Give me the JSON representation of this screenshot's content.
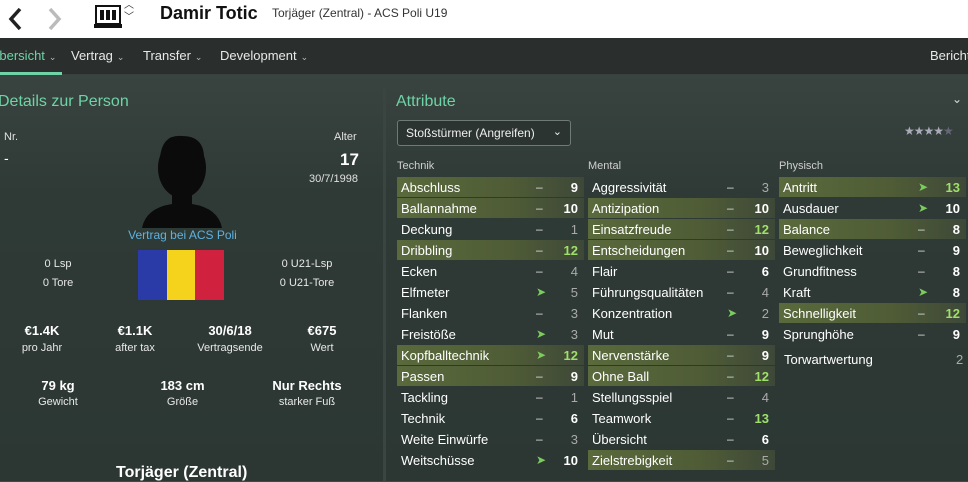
{
  "header": {
    "back_icon": "chevron-left-icon",
    "forward_icon": "chevron-right-icon",
    "name": "Damir Totic",
    "subtitle": "Torjäger (Zentral) - ACS Poli U19"
  },
  "menu": {
    "items": [
      {
        "label": "Übersicht",
        "active": true
      },
      {
        "label": "Vertrag"
      },
      {
        "label": "Transfer"
      },
      {
        "label": "Development"
      }
    ],
    "right_label": "Bericht"
  },
  "details": {
    "title": "Details zur Person",
    "nr_label": "Nr.",
    "nr_value": "-",
    "age_label": "Alter",
    "age_value": "17",
    "birthdate": "30/7/1998",
    "contract_text": "Vertrag bei ACS Poli",
    "lsp": "0 Lsp",
    "tore": "0 Tore",
    "u21lsp": "0 U21-Lsp",
    "u21tore": "0 U21-Tore",
    "stats": [
      {
        "value": "€1.4K",
        "label": "pro Jahr"
      },
      {
        "value": "€1.1K",
        "label": "after tax"
      },
      {
        "value": "30/6/18",
        "label": "Vertragsende"
      },
      {
        "value": "€675",
        "label": "Wert"
      }
    ],
    "body": [
      {
        "value": "79 kg",
        "label": "Gewicht"
      },
      {
        "value": "183 cm",
        "label": "Größe"
      },
      {
        "value": "Nur Rechts",
        "label": "starker Fuß"
      }
    ],
    "position": "Torjäger (Zentral)"
  },
  "attributes": {
    "title": "Attribute",
    "role": "Stoßstürmer (Angreifen)",
    "rating_stars": 4.5,
    "technik_label": "Technik",
    "mental_label": "Mental",
    "physisch_label": "Physisch",
    "technik": [
      {
        "n": "Abschluss",
        "t": "–",
        "v": "9",
        "h": true,
        "c": "mid"
      },
      {
        "n": "Ballannahme",
        "t": "–",
        "v": "10",
        "h": true,
        "c": "mid"
      },
      {
        "n": "Deckung",
        "t": "–",
        "v": "1",
        "h": false,
        "c": "lo"
      },
      {
        "n": "Dribbling",
        "t": "–",
        "v": "12",
        "h": true,
        "c": "hi"
      },
      {
        "n": "Ecken",
        "t": "–",
        "v": "4",
        "h": false,
        "c": "lo"
      },
      {
        "n": "Elfmeter",
        "t": "➤",
        "v": "5",
        "h": false,
        "c": "lo"
      },
      {
        "n": "Flanken",
        "t": "–",
        "v": "3",
        "h": false,
        "c": "lo"
      },
      {
        "n": "Freistöße",
        "t": "➤",
        "v": "3",
        "h": false,
        "c": "lo"
      },
      {
        "n": "Kopfballtechnik",
        "t": "➤",
        "v": "12",
        "h": true,
        "c": "hi"
      },
      {
        "n": "Passen",
        "t": "–",
        "v": "9",
        "h": true,
        "c": "mid"
      },
      {
        "n": "Tackling",
        "t": "–",
        "v": "1",
        "h": false,
        "c": "lo"
      },
      {
        "n": "Technik",
        "t": "–",
        "v": "6",
        "h": false,
        "c": "mid"
      },
      {
        "n": "Weite Einwürfe",
        "t": "–",
        "v": "3",
        "h": false,
        "c": "lo"
      },
      {
        "n": "Weitschüsse",
        "t": "➤",
        "v": "10",
        "h": false,
        "c": "mid"
      }
    ],
    "mental": [
      {
        "n": "Aggressivität",
        "t": "–",
        "v": "3",
        "h": false,
        "c": "lo"
      },
      {
        "n": "Antizipation",
        "t": "–",
        "v": "10",
        "h": true,
        "c": "mid"
      },
      {
        "n": "Einsatzfreude",
        "t": "–",
        "v": "12",
        "h": true,
        "c": "hi"
      },
      {
        "n": "Entscheidungen",
        "t": "–",
        "v": "10",
        "h": true,
        "c": "mid"
      },
      {
        "n": "Flair",
        "t": "–",
        "v": "6",
        "h": false,
        "c": "mid"
      },
      {
        "n": "Führungsqualitäten",
        "t": "–",
        "v": "4",
        "h": false,
        "c": "lo"
      },
      {
        "n": "Konzentration",
        "t": "➤",
        "v": "2",
        "h": false,
        "c": "lo"
      },
      {
        "n": "Mut",
        "t": "–",
        "v": "9",
        "h": false,
        "c": "mid"
      },
      {
        "n": "Nervenstärke",
        "t": "–",
        "v": "9",
        "h": true,
        "c": "mid"
      },
      {
        "n": "Ohne Ball",
        "t": "–",
        "v": "12",
        "h": true,
        "c": "hi"
      },
      {
        "n": "Stellungsspiel",
        "t": "–",
        "v": "4",
        "h": false,
        "c": "lo"
      },
      {
        "n": "Teamwork",
        "t": "–",
        "v": "13",
        "h": false,
        "c": "hi"
      },
      {
        "n": "Übersicht",
        "t": "–",
        "v": "6",
        "h": false,
        "c": "mid"
      },
      {
        "n": "Zielstrebigkeit",
        "t": "–",
        "v": "5",
        "h": true,
        "c": "lo"
      }
    ],
    "physisch": [
      {
        "n": "Antritt",
        "t": "➤",
        "v": "13",
        "h": true,
        "c": "hi"
      },
      {
        "n": "Ausdauer",
        "t": "➤",
        "v": "10",
        "h": false,
        "c": "mid"
      },
      {
        "n": "Balance",
        "t": "–",
        "v": "8",
        "h": true,
        "c": "mid"
      },
      {
        "n": "Beweglichkeit",
        "t": "–",
        "v": "9",
        "h": false,
        "c": "mid"
      },
      {
        "n": "Grundfitness",
        "t": "–",
        "v": "8",
        "h": false,
        "c": "mid"
      },
      {
        "n": "Kraft",
        "t": "➤",
        "v": "8",
        "h": false,
        "c": "mid"
      },
      {
        "n": "Schnelligkeit",
        "t": "–",
        "v": "12",
        "h": true,
        "c": "hi"
      },
      {
        "n": "Sprunghöhe",
        "t": "–",
        "v": "9",
        "h": false,
        "c": "mid"
      }
    ],
    "gk_label": "Torwartwertung",
    "gk_value": "2"
  }
}
